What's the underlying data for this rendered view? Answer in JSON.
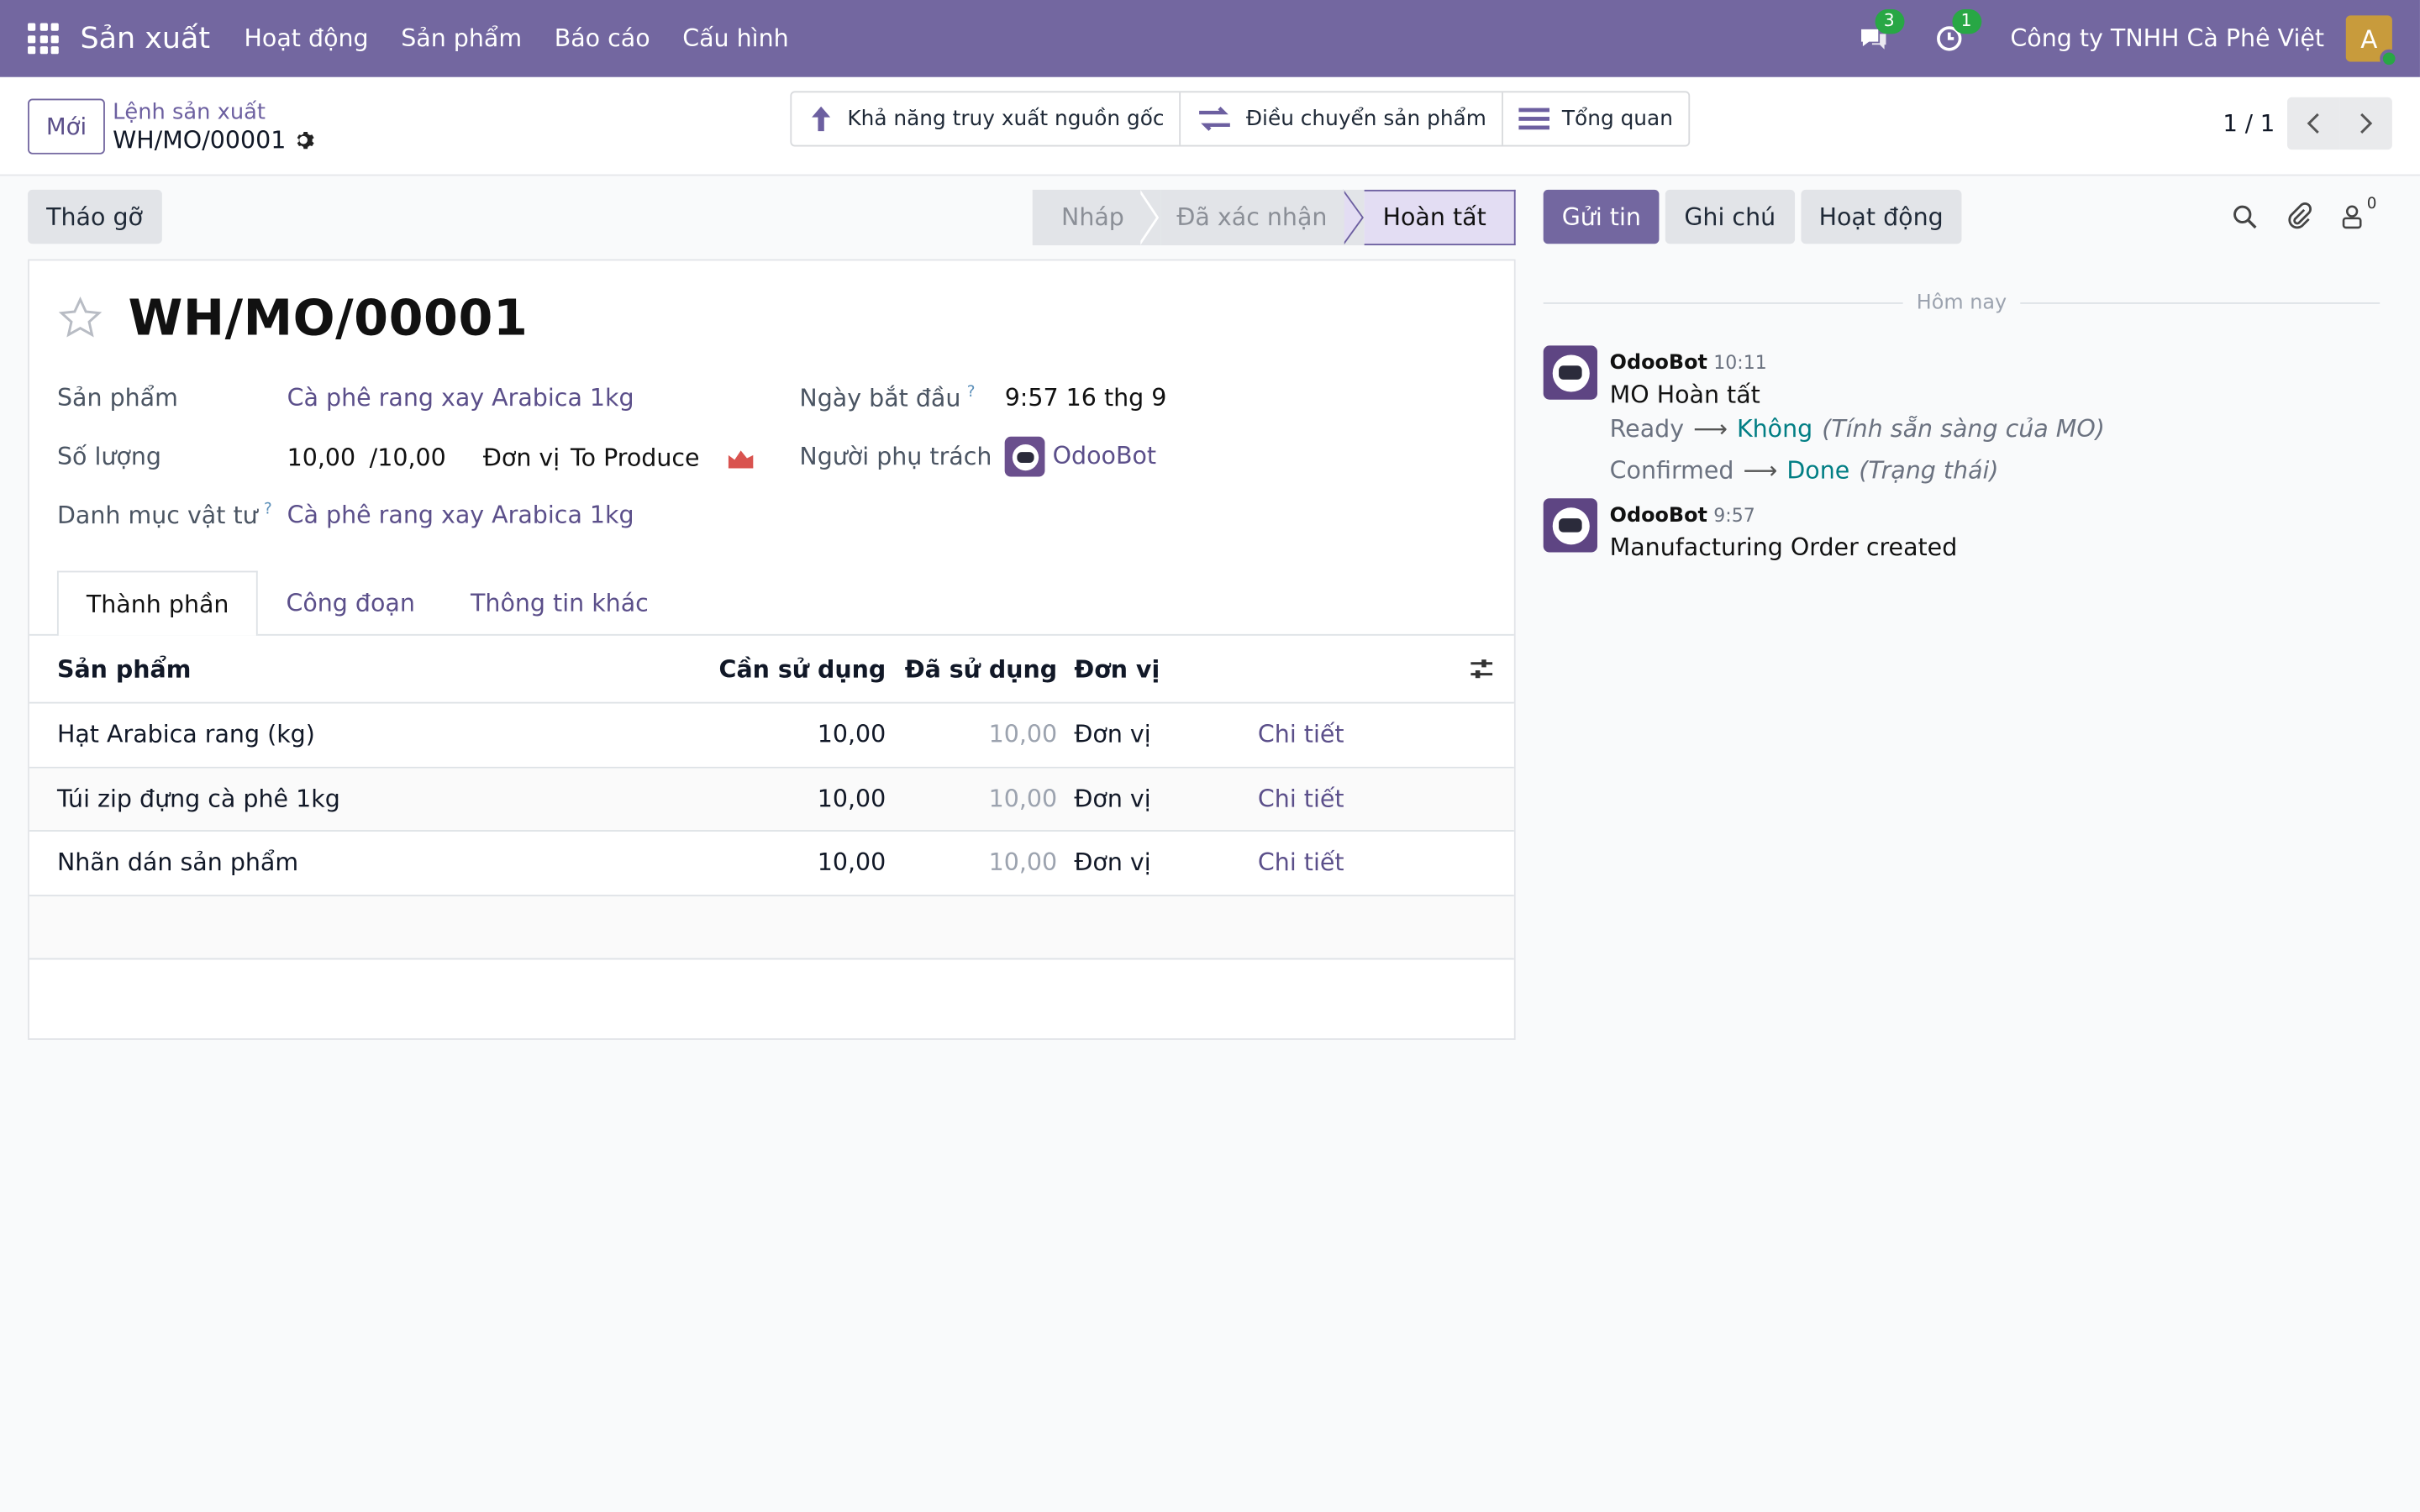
{
  "navbar": {
    "app_name": "Sản xuất",
    "menu": [
      "Hoạt động",
      "Sản phẩm",
      "Báo cáo",
      "Cấu hình"
    ],
    "messages_count": "3",
    "activities_count": "1",
    "company": "Công ty TNHH Cà Phê Việt",
    "avatar_letter": "A"
  },
  "control_panel": {
    "new_label": "Mới",
    "breadcrumb_parent": "Lệnh sản xuất",
    "breadcrumb_current": "WH/MO/00001",
    "smart_buttons": [
      "Khả năng truy xuất nguồn gốc",
      "Điều chuyển sản phẩm",
      "Tổng quan"
    ],
    "pager": "1 / 1"
  },
  "statusbar": {
    "unbuild_label": "Tháo gỡ",
    "stages": [
      "Nháp",
      "Đã xác nhận",
      "Hoàn tất"
    ],
    "current_stage": "Hoàn tất"
  },
  "form": {
    "title": "WH/MO/00001",
    "product_label": "Sản phẩm",
    "product_value": "Cà phê rang xay Arabica 1kg",
    "quantity_label": "Số lượng",
    "qty_produced": "10,00",
    "qty_total": "/10,00",
    "qty_uom": "Đơn vị",
    "qty_to_produce": "To Produce",
    "bom_label": "Danh mục vật tư",
    "bom_value": "Cà phê rang xay Arabica 1kg",
    "start_label": "Ngày bắt đầu",
    "start_value": "9:57 16 thg 9",
    "responsible_label": "Người phụ trách",
    "responsible_value": "OdooBot",
    "help_mark": "?"
  },
  "tabs": [
    "Thành phần",
    "Công đoạn",
    "Thông tin khác"
  ],
  "table": {
    "headers": {
      "product": "Sản phẩm",
      "to_consume": "Cần sử dụng",
      "consumed": "Đã sử dụng",
      "uom": "Đơn vị"
    },
    "rows": [
      {
        "product": "Hạt Arabica rang (kg)",
        "to_consume": "10,00",
        "consumed": "10,00",
        "uom": "Đơn vị",
        "detail": "Chi tiết"
      },
      {
        "product": "Túi zip đựng cà phê 1kg",
        "to_consume": "10,00",
        "consumed": "10,00",
        "uom": "Đơn vị",
        "detail": "Chi tiết"
      },
      {
        "product": "Nhãn dán sản phẩm",
        "to_consume": "10,00",
        "consumed": "10,00",
        "uom": "Đơn vị",
        "detail": "Chi tiết"
      }
    ]
  },
  "chatter": {
    "send_message": "Gửi tin",
    "log_note": "Ghi chú",
    "activity": "Hoạt động",
    "followers_count": "0",
    "date_separator": "Hôm nay",
    "messages": [
      {
        "author": "OdooBot",
        "time": "10:11",
        "text": "MO Hoàn tất",
        "tracking": [
          {
            "old": "Ready",
            "new": "Không",
            "field": "(Tính sẵn sàng của MO)"
          },
          {
            "old": "Confirmed",
            "new": "Done",
            "field": "(Trạng thái)"
          }
        ]
      },
      {
        "author": "OdooBot",
        "time": "9:57",
        "text": "Manufacturing Order created"
      }
    ]
  },
  "colors": {
    "brand": "#7367a0",
    "link": "#5b4f8a",
    "tracking_new": "#017e84",
    "badge": "#28a745"
  }
}
